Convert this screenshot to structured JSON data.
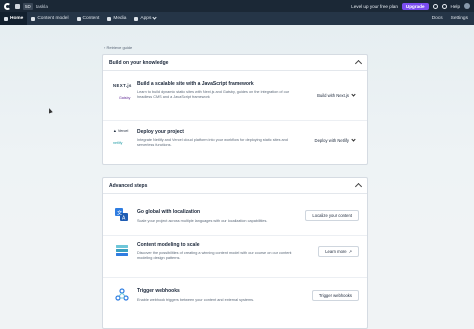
{
  "topbar": {
    "space": "taskla",
    "plan_text": "Level up your free plan",
    "upgrade_label": "Upgrade",
    "help_label": "Help"
  },
  "nav": {
    "items": [
      {
        "label": "Home",
        "icon": "home-icon"
      },
      {
        "label": "Content model",
        "icon": "wrench-icon"
      },
      {
        "label": "Content",
        "icon": "pencil-icon"
      },
      {
        "label": "Media",
        "icon": "image-icon"
      },
      {
        "label": "Apps",
        "icon": "apps-icon"
      }
    ],
    "docs_label": "Docs",
    "settings_label": "Settings"
  },
  "back_link": "Retrieve guide",
  "knowledge": {
    "title": "Build on your knowledge",
    "rows": [
      {
        "logo": "NEXT.js",
        "logo2": "Gatsby",
        "title": "Build a scalable site with a JavaScript framework",
        "desc": "Learn to build dynamic static sites with Next.js and Gatsby, guides on the integration of our headless CMS and a JavaScript framework",
        "action": "Build with Next.js"
      },
      {
        "logo": "Vercel",
        "logo2": "netlify",
        "title": "Deploy your project",
        "desc": "Integrate Netlify and Vercel cloud platform into your workflow for deploying static sites and serverless functions.",
        "action": "Deploy with Netlify"
      }
    ]
  },
  "advanced": {
    "title": "Advanced steps",
    "rows": [
      {
        "icon": "localization-icon",
        "title": "Go global with localization",
        "desc": "Scale your project across multiple languages with our localization capabilities.",
        "action": "Localize your content"
      },
      {
        "icon": "layers-icon",
        "title": "Content modeling to scale",
        "desc": "Discover the possibilities of creating a winning content model with our course on our content modeling design patterns.",
        "action": "Learn more"
      },
      {
        "icon": "webhook-icon",
        "title": "Trigger webhooks",
        "desc": "Enable webhook triggers between your content and external systems.",
        "action": "Trigger webhooks"
      }
    ]
  },
  "colors": {
    "topbar": "#1b2836",
    "navbar": "#253547",
    "upgrade": "#7a4cf0",
    "accent_blue": "#2f7de1"
  }
}
